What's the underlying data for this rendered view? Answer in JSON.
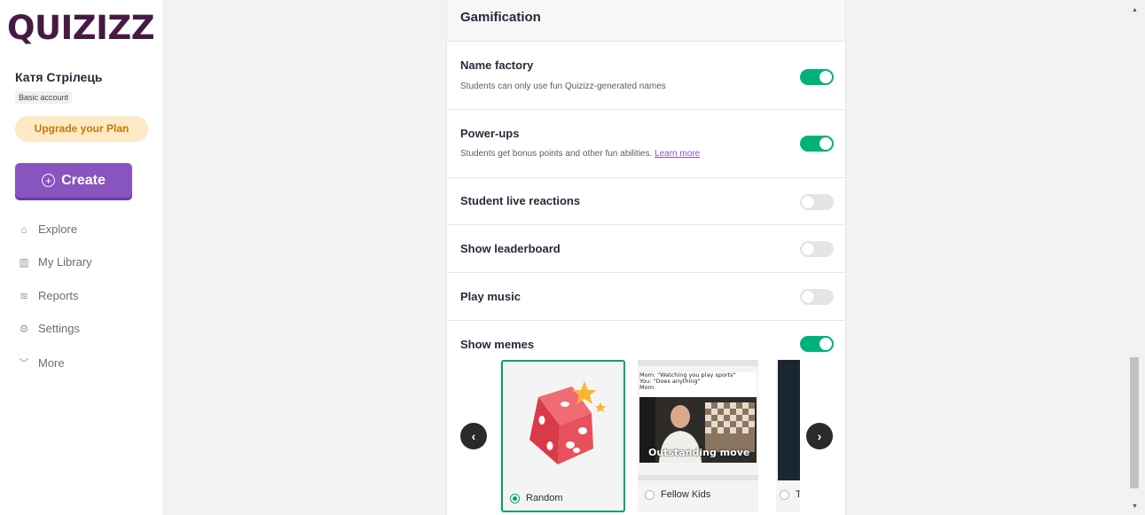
{
  "sidebar": {
    "logo": "QUIZIZZ",
    "username": "Катя Стрілець",
    "account_type": "Basic account",
    "upgrade_label": "Upgrade your Plan",
    "create_label": "Create",
    "nav": [
      {
        "label": "Explore",
        "icon": "explore-icon"
      },
      {
        "label": "My Library",
        "icon": "library-icon"
      },
      {
        "label": "Reports",
        "icon": "reports-icon"
      },
      {
        "label": "Settings",
        "icon": "settings-icon"
      },
      {
        "label": "More",
        "icon": "chevron-down-icon"
      }
    ]
  },
  "settings": {
    "section_title": "Gamification",
    "rows": [
      {
        "title": "Name factory",
        "desc": "Students can only use fun Quizizz-generated names",
        "on": true
      },
      {
        "title": "Power-ups",
        "desc": "Students get bonus points and other fun abilities.",
        "link": "Learn more",
        "on": true
      },
      {
        "title": "Student live reactions",
        "on": false
      },
      {
        "title": "Show leaderboard",
        "on": false
      },
      {
        "title": "Play music",
        "on": false
      },
      {
        "title": "Show memes",
        "on": true
      }
    ]
  },
  "memes": {
    "items": [
      {
        "label": "Random",
        "selected": true
      },
      {
        "label": "Fellow Kids",
        "selected": false,
        "caption": "Mom: \"Watching you play sports\"\nYou: \"Does anything\"\nMom:",
        "overlay": "Outstanding move"
      },
      {
        "label": "T",
        "selected": false
      }
    ]
  },
  "colors": {
    "brand": "#461a42",
    "accent": "#8854c0",
    "toggle_on": "#00b27a",
    "upgrade_bg": "#fde9c5"
  }
}
